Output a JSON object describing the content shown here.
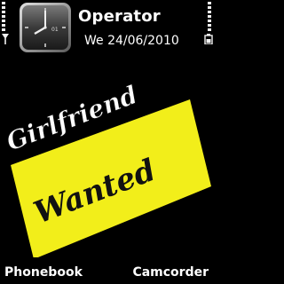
{
  "status": {
    "signal_icon": "antenna-icon",
    "battery_icon": "battery-icon",
    "signal_level": 7,
    "battery_level": 7
  },
  "clock": {
    "type": "analog",
    "mini_label": "01",
    "icon": "clock-icon"
  },
  "header": {
    "operator": "Operator",
    "date": "We 24/06/2010"
  },
  "wallpaper": {
    "line1": "Girlfriend",
    "line2": "Wanted",
    "sign_color": "#f2ee1a",
    "text_color": "#111111",
    "script_color": "#ffffff"
  },
  "softkeys": {
    "left": "Phonebook",
    "right": "Camcorder"
  }
}
